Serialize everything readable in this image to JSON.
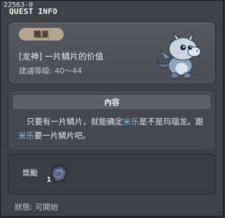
{
  "window": {
    "quest_id": "22563-0",
    "title": "QUEST INFO"
  },
  "quest": {
    "job_badge": "職業",
    "name": "[龙神]  一片鳞片的价值",
    "required_level": "建議等級: 40～44",
    "creature_icon": "baby-dragon-icon"
  },
  "content": {
    "header": "內容",
    "segments": [
      {
        "text": "只要有一片鳞片，就能确定",
        "highlight": false
      },
      {
        "text": "米乐",
        "highlight": true
      },
      {
        "text": "是不是玛瑙龙。跟",
        "highlight": false
      },
      {
        "text": "米乐",
        "highlight": true
      },
      {
        "text": "要一片鳞片吧。",
        "highlight": false
      }
    ],
    "highlight_color": "#63c6ff"
  },
  "reward": {
    "label": "獎勵",
    "item_icon": "dragon-scale-icon",
    "count": "1"
  },
  "status": "狀態:  可開始"
}
